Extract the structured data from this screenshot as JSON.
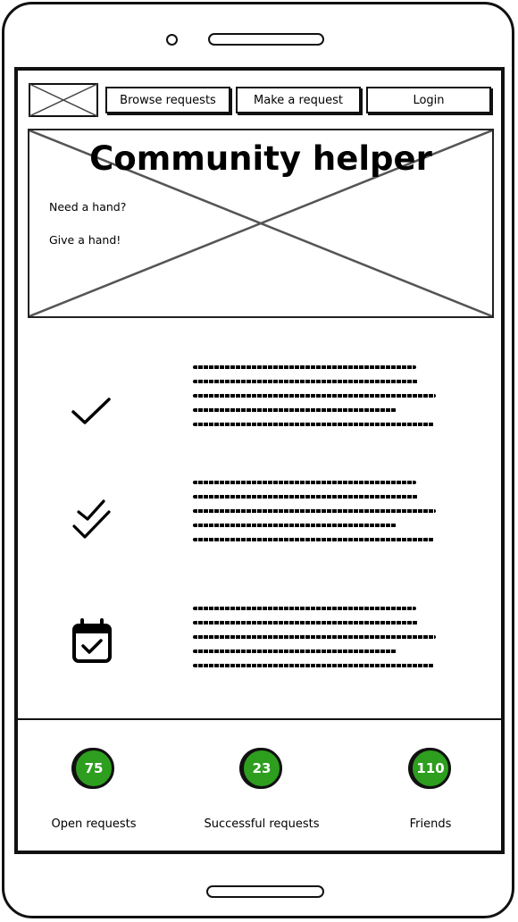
{
  "nav": {
    "browse_label": "Browse requests",
    "make_label": "Make a request",
    "login_label": "Login"
  },
  "hero": {
    "title": "Community helper",
    "line1": "Need a hand?",
    "line2": "Give a hand!"
  },
  "features": [
    {
      "icon": "check-icon"
    },
    {
      "icon": "double-check-icon"
    },
    {
      "icon": "calendar-check-icon"
    }
  ],
  "stats": [
    {
      "value": "75",
      "label": "Open requests"
    },
    {
      "value": "23",
      "label": "Successful requests"
    },
    {
      "value": "110",
      "label": "Friends"
    }
  ],
  "colors": {
    "badge": "#2e9e1f",
    "ink": "#111111"
  }
}
